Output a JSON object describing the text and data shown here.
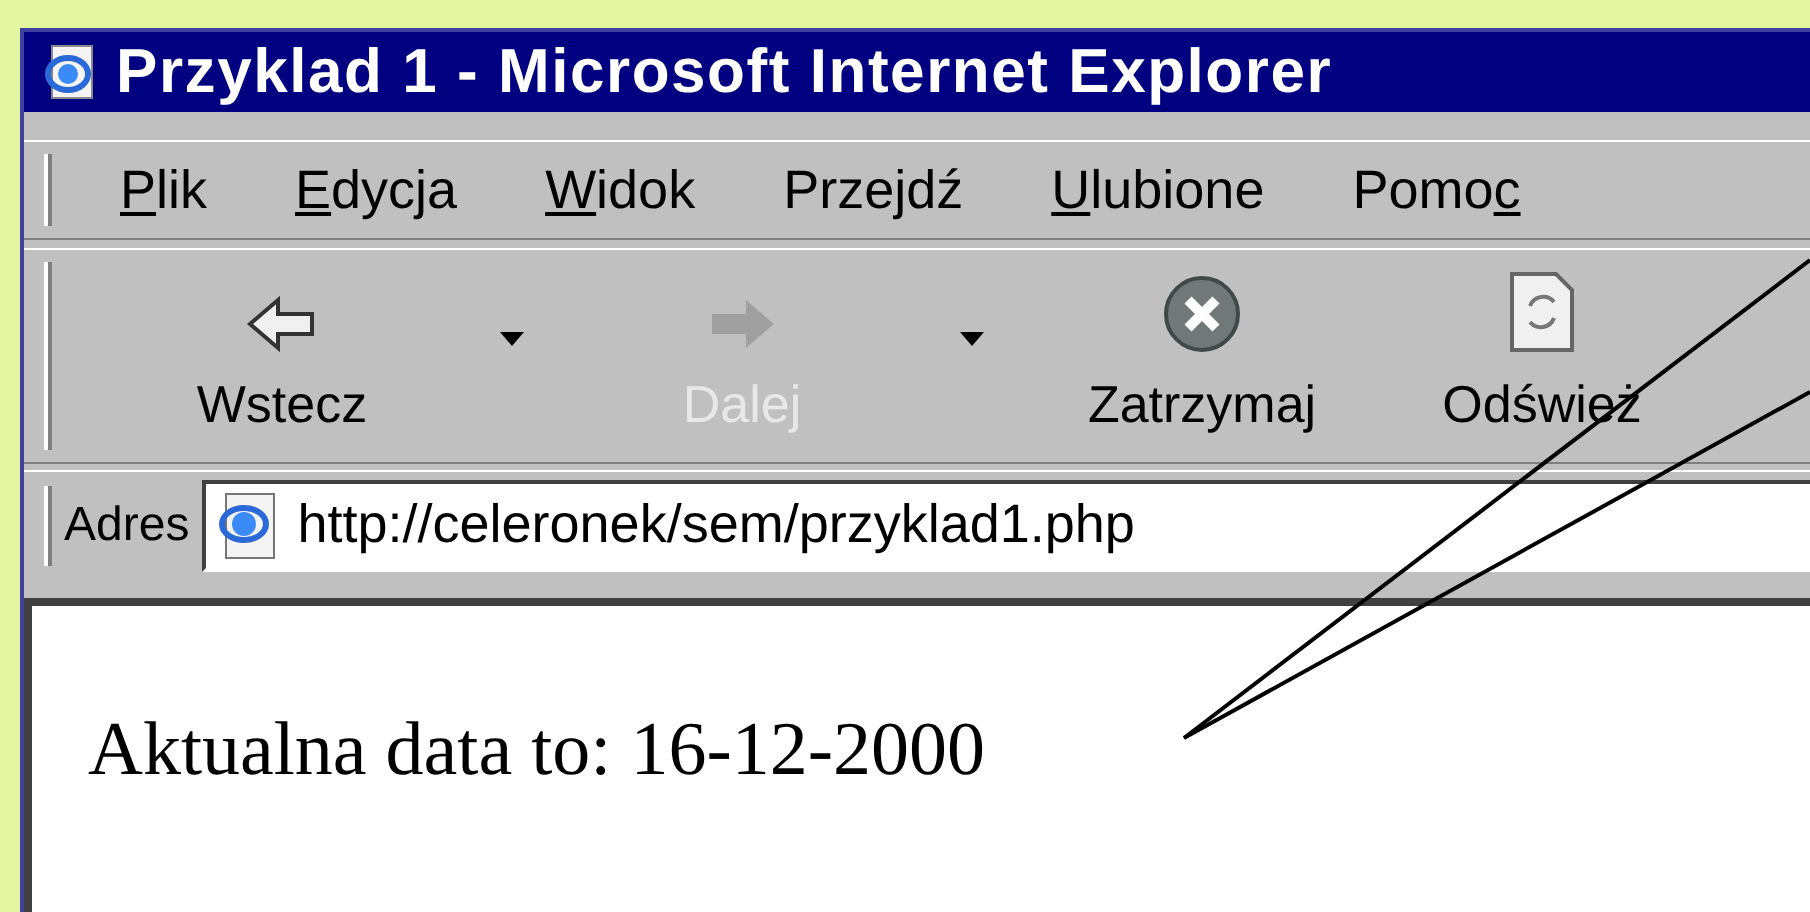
{
  "window": {
    "title": "Przyklad 1 - Microsoft Internet Explorer"
  },
  "menu": [
    {
      "key": "P",
      "post": "lik"
    },
    {
      "key": "E",
      "post": "dycja"
    },
    {
      "key": "W",
      "post": "idok"
    },
    {
      "pre": "Prze",
      "key": "j",
      "post": "dź"
    },
    {
      "key": "U",
      "post": "lubione"
    },
    {
      "pre": "Pomo",
      "key": "c"
    }
  ],
  "toolbar": [
    {
      "kind": "back",
      "label": "Wstecz",
      "disabled": false,
      "dropdown": true
    },
    {
      "kind": "forward",
      "label": "Dalej",
      "disabled": true,
      "dropdown": true
    },
    {
      "kind": "stop",
      "label": "Zatrzymaj",
      "disabled": false,
      "dropdown": false
    },
    {
      "kind": "refresh",
      "label": "Odśwież",
      "disabled": false,
      "dropdown": false
    }
  ],
  "address": {
    "label": "Adres",
    "value": "http://celeronek/sem/przyklad1.php"
  },
  "content": {
    "text": "Aktualna data to: 16-12-2000"
  }
}
